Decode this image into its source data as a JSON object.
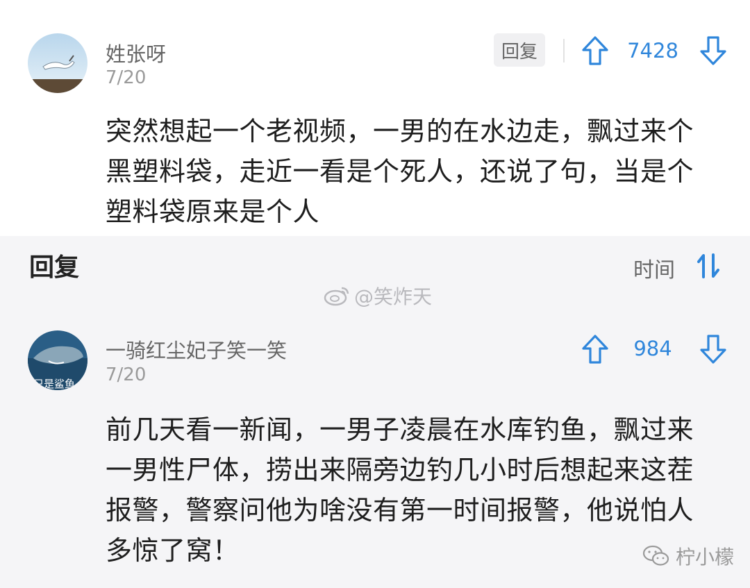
{
  "comment": {
    "username": "姓张呀",
    "date": "7/20",
    "reply_label": "回复",
    "upvotes": "7428",
    "text": "突然想起一个老视频，一男的在水边走，飘过来个\n黑塑料袋，走近一看是个死人，还说了句，当是个\n塑料袋原来是个人"
  },
  "replies_header": {
    "title": "回复",
    "sort_label": "时间"
  },
  "watermark_weibo": "@笑炸天",
  "reply": {
    "username": "一骑红尘妃子笑一笑",
    "date": "7/20",
    "avatar_text": "只是鲨鱼",
    "upvotes": "984",
    "text": "前几天看一新闻，一男子凌晨在水库钓鱼，飘过来\n一男性尸体，捞出来隔旁边钓几小时后想起来这茬\n报警，警察问他为啥没有第一时间报警，他说怕人\n多惊了窝！"
  },
  "watermark_wechat": "柠小檬",
  "colors": {
    "accent": "#2f86db",
    "card": "#ffffff",
    "background": "#f5f5f7"
  },
  "icons": [
    "upvote-icon",
    "downvote-icon",
    "sort-icon",
    "weibo-icon",
    "wechat-icon"
  ]
}
